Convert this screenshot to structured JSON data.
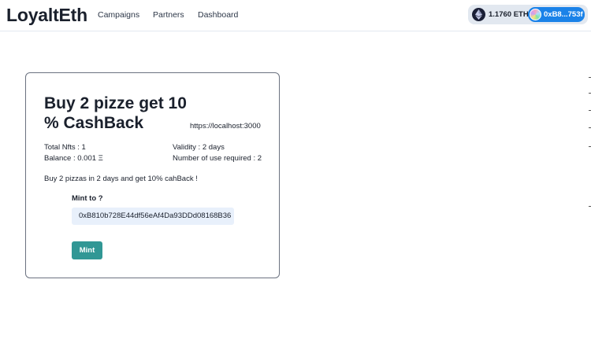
{
  "brand": {
    "name": "LoyaltEth"
  },
  "nav": {
    "links": [
      "Campaigns",
      "Partners",
      "Dashboard"
    ]
  },
  "wallet": {
    "balance": "1.1760 ETH",
    "address": "0xB8...753f",
    "icon": "ethereum-icon",
    "colors": {
      "pill": "#e2e8f0",
      "account": "#1a82e8"
    }
  },
  "campaign": {
    "title": "Buy 2 pizze get 10 % CashBack",
    "url": "https://localhost:3000",
    "total_nfts": "Total Nfts : 1",
    "balance": "Balance : 0.001 Ξ",
    "validity": "Validity : 2 days",
    "uses_required": "Number of use required : 2",
    "description": "Buy 2 pizzas in 2 days and get 10% cahBack !",
    "mint_label": "Mint to ?",
    "mint_input_value": "0xB810b728E44df56eAf4Da93DDd08168B36",
    "mint_button": "Mint",
    "colors": {
      "mint_button": "#319795",
      "input_bg": "#e8f0fb"
    }
  }
}
